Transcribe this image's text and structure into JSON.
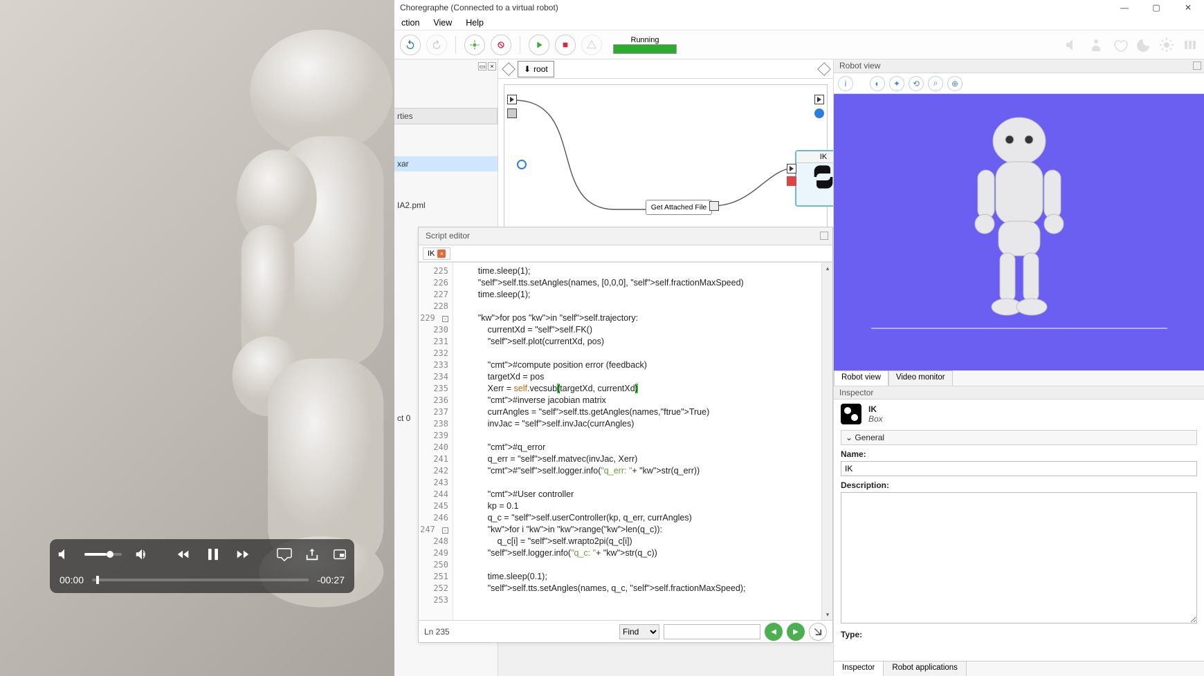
{
  "window": {
    "title": "Choregraphe (Connected to a virtual robot)"
  },
  "menu": {
    "items": [
      "ction",
      "View",
      "Help"
    ]
  },
  "toolbar": {
    "status_label": "Running"
  },
  "breadcrumb": {
    "root": "root"
  },
  "flow": {
    "ik_node": "IK",
    "gaf_node": "Get Attached File"
  },
  "project": {
    "prop": "rties",
    "r1": "xar",
    "r2": "IA2.pml",
    "r3": "ct 0"
  },
  "script": {
    "panel_title": "Script editor",
    "tab": "IK",
    "status": "Ln 235",
    "find_label": "Find",
    "lines": [
      {
        "n": 225,
        "t": "        time.sleep(1);"
      },
      {
        "n": 226,
        "t": "        self.tts.setAngles(names, [0,0,0], self.fractionMaxSpeed)"
      },
      {
        "n": 227,
        "t": "        time.sleep(1);"
      },
      {
        "n": 228,
        "t": ""
      },
      {
        "n": 229,
        "t": "        for pos in self.trajectory:",
        "fold": true
      },
      {
        "n": 230,
        "t": "            currentXd = self.FK()"
      },
      {
        "n": 231,
        "t": "            self.plot(currentXd, pos)"
      },
      {
        "n": 232,
        "t": ""
      },
      {
        "n": 233,
        "t": "            #compute position error (feedback)"
      },
      {
        "n": 234,
        "t": "            targetXd = pos"
      },
      {
        "n": 235,
        "t": "            Xerr = self.vecsub(targetXd, currentXd)",
        "hl": true
      },
      {
        "n": 236,
        "t": "            #inverse jacobian matrix"
      },
      {
        "n": 237,
        "t": "            currAngles = self.tts.getAngles(names,True)"
      },
      {
        "n": 238,
        "t": "            invJac = self.invJac(currAngles)"
      },
      {
        "n": 239,
        "t": ""
      },
      {
        "n": 240,
        "t": "            #q_error"
      },
      {
        "n": 241,
        "t": "            q_err = self.matvec(invJac, Xerr)"
      },
      {
        "n": 242,
        "t": "            #self.logger.info(\"q_err: \"+ str(q_err))"
      },
      {
        "n": 243,
        "t": ""
      },
      {
        "n": 244,
        "t": "            #User controller"
      },
      {
        "n": 245,
        "t": "            kp = 0.1"
      },
      {
        "n": 246,
        "t": "            q_c = self.userController(kp, q_err, currAngles)"
      },
      {
        "n": 247,
        "t": "            for i in range(len(q_c)):",
        "fold": true
      },
      {
        "n": 248,
        "t": "                q_c[i] = self.wrapto2pi(q_c[i])"
      },
      {
        "n": 249,
        "t": "            self.logger.info(\"q_c: \"+ str(q_c))"
      },
      {
        "n": 250,
        "t": ""
      },
      {
        "n": 251,
        "t": "            time.sleep(0.1);"
      },
      {
        "n": 252,
        "t": "            self.tts.setAngles(names, q_c, self.fractionMaxSpeed);"
      },
      {
        "n": 253,
        "t": ""
      }
    ]
  },
  "robotview": {
    "title": "Robot view",
    "tab1": "Robot view",
    "tab2": "Video monitor"
  },
  "inspector": {
    "title": "Inspector",
    "box_name": "IK",
    "box_type": "Box",
    "section": "General",
    "name_label": "Name:",
    "name_value": "IK",
    "desc_label": "Description:",
    "type_label": "Type:",
    "tab1": "Inspector",
    "tab2": "Robot applications"
  },
  "video": {
    "t_cur": "00:00",
    "t_rem": "-00:27"
  }
}
